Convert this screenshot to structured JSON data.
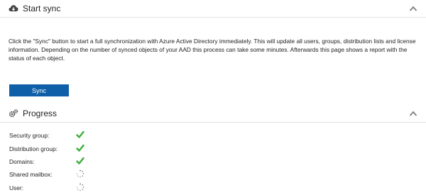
{
  "sync_panel": {
    "title": "Start sync",
    "header_icon": "cloud-download-icon",
    "collapse_icon": "chevron-up-icon",
    "description": "Click the \"Sync\" button to start a full synchronization with Azure Active Directory immediately. This will update all users, groups, distribution lists and license information. Depending on the number of synced objects of your AAD this process can take some minutes. Afterwards this page shows a report with the status of each object.",
    "sync_button_label": "Sync"
  },
  "progress_panel": {
    "title": "Progress",
    "header_icon": "gears-icon",
    "collapse_icon": "chevron-up-icon",
    "items": [
      {
        "label": "Security group:",
        "status": "done"
      },
      {
        "label": "Distribution group:",
        "status": "done"
      },
      {
        "label": "Domains:",
        "status": "done"
      },
      {
        "label": "Shared mailbox:",
        "status": "loading"
      },
      {
        "label": "User:",
        "status": "loading"
      }
    ]
  },
  "colors": {
    "accent": "#0f5fa8",
    "success": "#3cae3c",
    "spinner": "#888888",
    "divider": "#e2e2e2"
  }
}
